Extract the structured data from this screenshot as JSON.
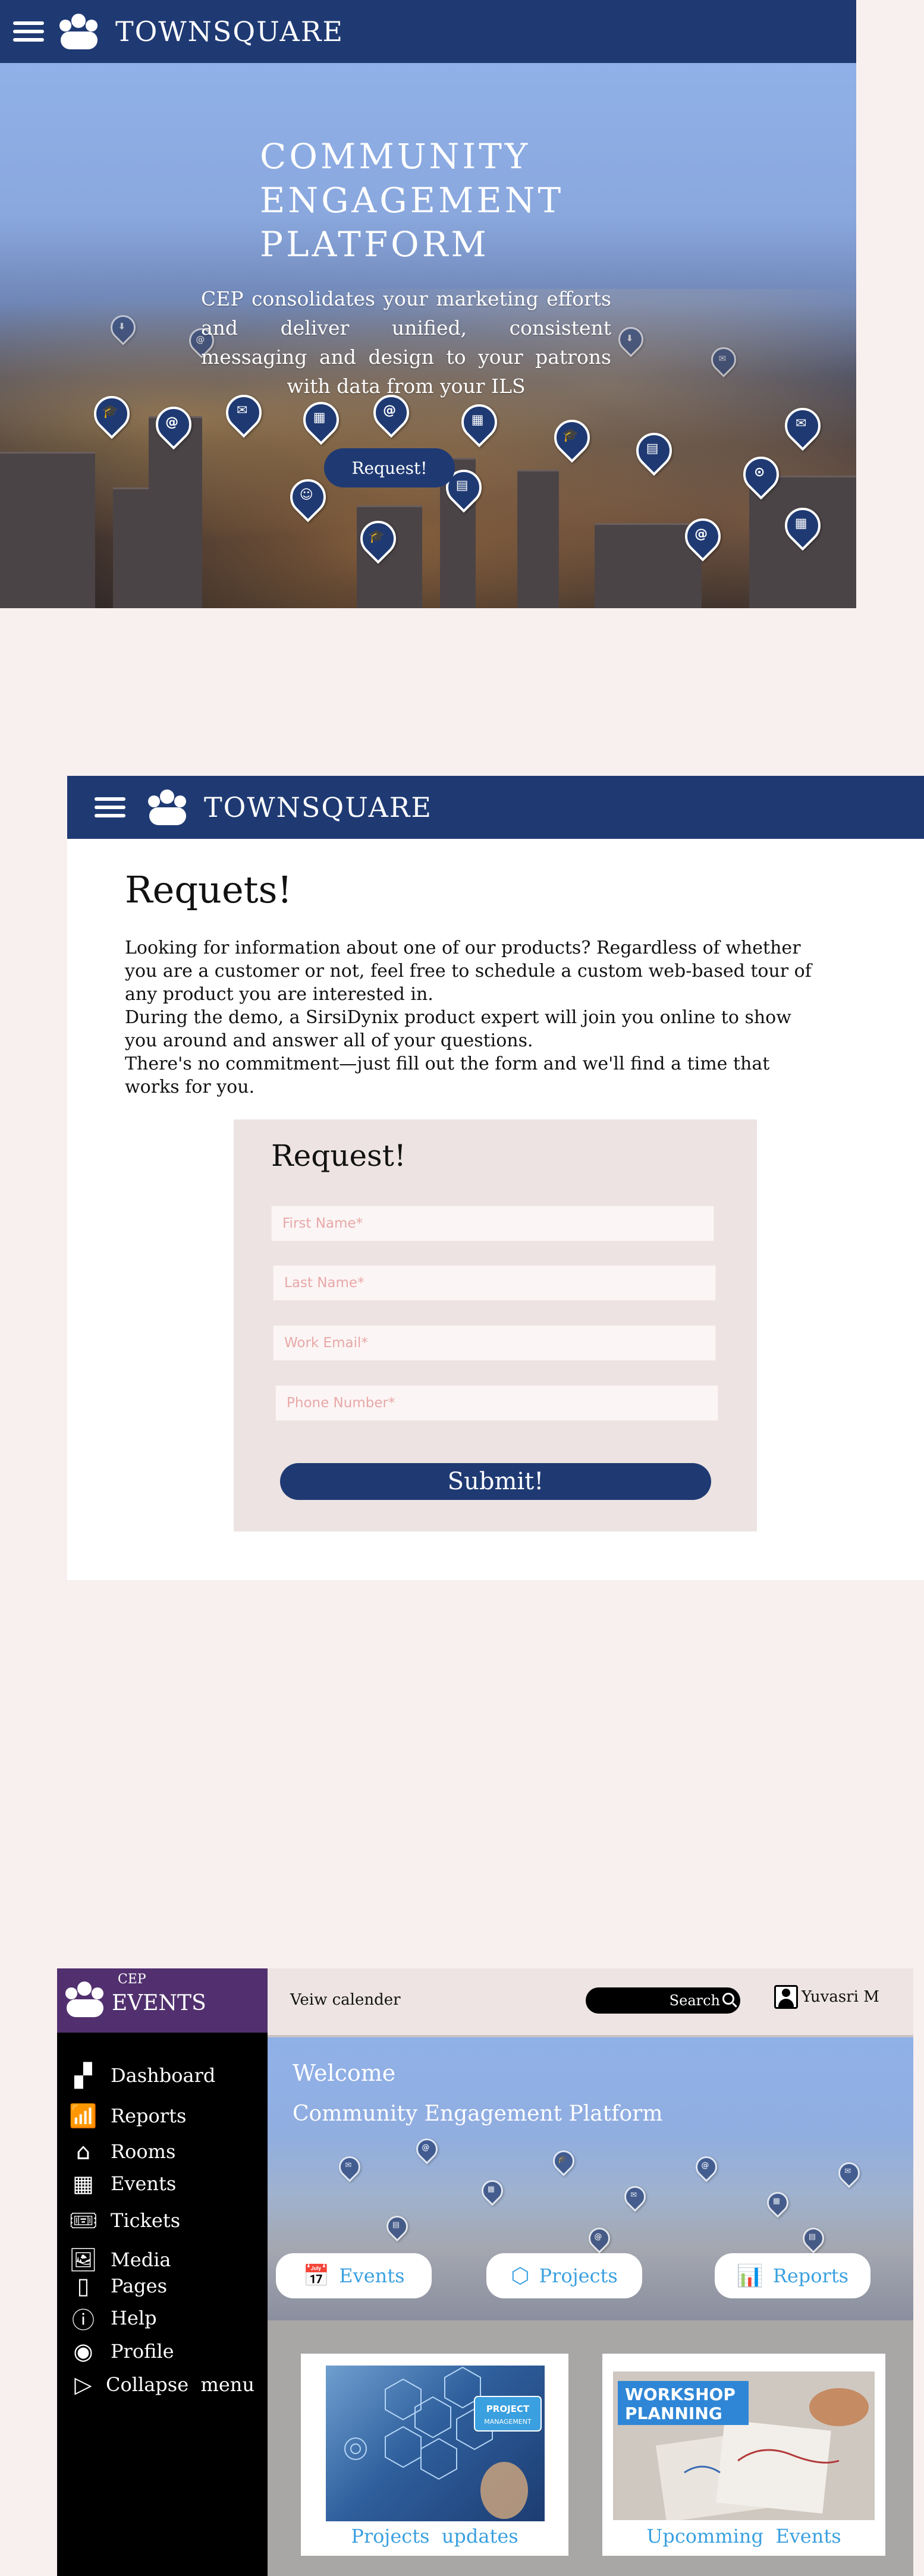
{
  "brand": "TOWNSQUARE",
  "hero": {
    "title_lines": [
      "COMMUNITY",
      "ENGAGEMENT",
      "PLATFORM"
    ],
    "text": "CEP consolidates your marketing efforts and deliver unified, consistent messaging and design to your patrons with data from your ILS",
    "button": "Request!"
  },
  "request_page": {
    "title": "Requets!",
    "paragraphs": [
      "Looking for information about one of our products? Regardless of whether you are a customer or not, feel free to schedule a custom web-based tour of any product you are interested in.",
      "During the demo, a SirsiDynix product expert will join you online to show you around and answer all of your questions.",
      "There's no commitment—just fill out the form and we'll find a time that works for you."
    ],
    "form": {
      "title": "Request!",
      "first_name_placeholder": "First Name*",
      "last_name_placeholder": "Last Name*",
      "email_placeholder": "Work Email*",
      "phone_placeholder": "Phone Number*",
      "submit": "Submit!"
    }
  },
  "dashboard": {
    "logo_small": "CEP",
    "logo_big": "EVENTS",
    "sidebar": [
      {
        "label": "Dashboard",
        "icon": "dashboard-icon"
      },
      {
        "label": "Reports",
        "icon": "reports-icon"
      },
      {
        "label": "Rooms",
        "icon": "rooms-icon"
      },
      {
        "label": "Events",
        "icon": "calendar-icon"
      },
      {
        "label": "Tickets",
        "icon": "tickets-icon"
      },
      {
        "label": "Media",
        "icon": "media-icon"
      },
      {
        "label": "Pages",
        "icon": "pages-icon"
      },
      {
        "label": "Help",
        "icon": "help-icon"
      },
      {
        "label": "Profile",
        "icon": "profile-icon"
      },
      {
        "label": "Collapse  menu",
        "icon": "collapse-icon"
      }
    ],
    "topbar": {
      "calendar_link": "Veiw calender",
      "search": "Search",
      "user": "Yuvasri M"
    },
    "banner": {
      "welcome": "Welcome",
      "subtitle": "Community Engagement Platform",
      "buttons": [
        "Events",
        "Projects",
        "Reports"
      ]
    },
    "cards": [
      {
        "caption": "Projects  updates",
        "image_text": "PROJECT MANAGEMENT"
      },
      {
        "caption": "Upcomming  Events",
        "image_text": "WORKSHOP PLANNING"
      }
    ]
  },
  "colors": {
    "navy": "#1f3a73",
    "purple": "#52306f",
    "accent_blue": "#3aa0e0",
    "page_bg": "#f8efef"
  }
}
